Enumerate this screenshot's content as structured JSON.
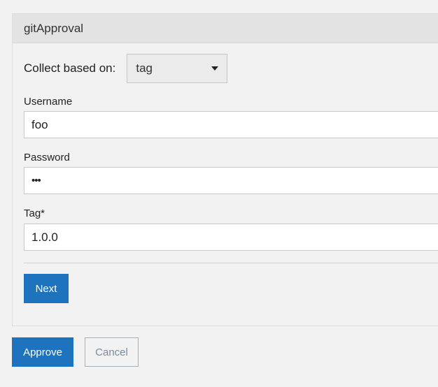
{
  "panel": {
    "title": "gitApproval",
    "collect": {
      "label": "Collect based on:",
      "selected": "tag",
      "caret_icon": "chevron-down-icon"
    },
    "fields": {
      "username": {
        "label": "Username",
        "value": "foo"
      },
      "password": {
        "label": "Password",
        "value": "•••"
      },
      "tag": {
        "label": "Tag*",
        "value": "1.0.0"
      }
    },
    "next_label": "Next"
  },
  "footer": {
    "approve_label": "Approve",
    "cancel_label": "Cancel"
  },
  "colors": {
    "primary": "#1e73be",
    "background": "#f2f2f2",
    "header": "#e3e3e3"
  }
}
